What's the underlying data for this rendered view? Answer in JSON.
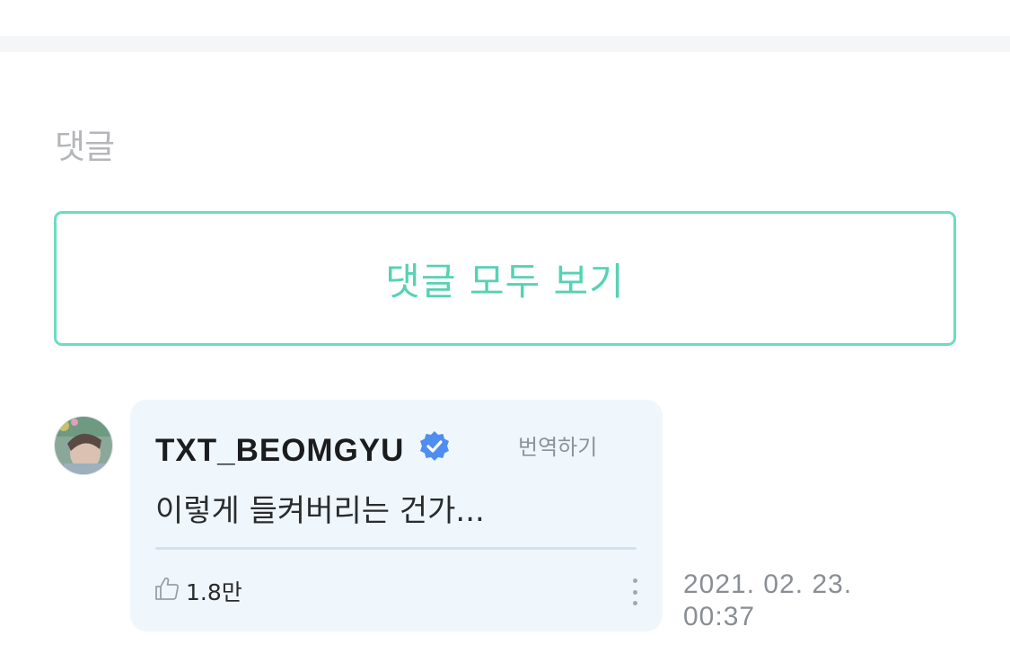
{
  "comments_section": {
    "title": "댓글",
    "view_all_label": "댓글 모두 보기"
  },
  "comment": {
    "author": "TXT_BEOMGYU",
    "verified_icon": "verified-badge-icon",
    "translate_label": "번역하기",
    "text": "이렇게 들켜버리는 건가...",
    "like_icon": "thumbs-up-icon",
    "like_count": "1.8만",
    "more_icon": "more-vertical-icon",
    "date": "2021. 02. 23.",
    "time": "00:37"
  },
  "colors": {
    "accent": "#56d2b4",
    "accent_border": "#6cdcc0",
    "verified": "#4f8ef0",
    "bubble_bg": "#eff7fc"
  }
}
